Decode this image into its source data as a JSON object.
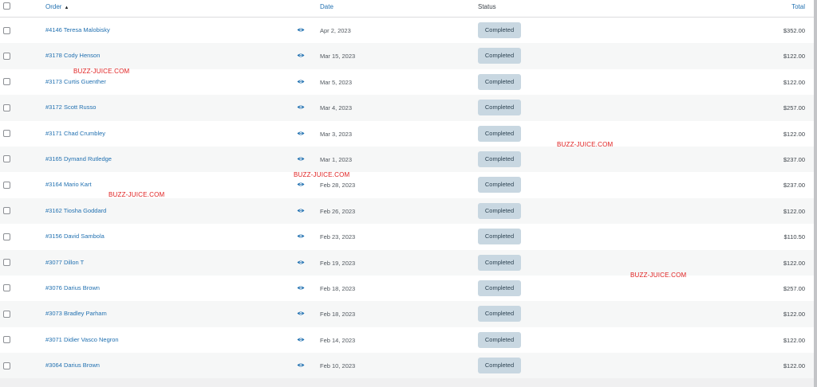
{
  "header": {
    "order_label": "Order",
    "sort_indicator": "▲",
    "date_label": "Date",
    "status_label": "Status",
    "total_label": "Total"
  },
  "icons": {
    "preview": "eye-icon",
    "sort": "sort-ascending-icon"
  },
  "colors": {
    "link": "#2271b1",
    "badge_bg": "#c8d7e1",
    "badge_text": "#2e4453",
    "watermark": "#e02020"
  },
  "orders": [
    {
      "order": "#4146 Teresa Malobisky",
      "date": "Apr 2, 2023",
      "status": "Completed",
      "total": "$352.00"
    },
    {
      "order": "#3178 Cody Henson",
      "date": "Mar 15, 2023",
      "status": "Completed",
      "total": "$122.00"
    },
    {
      "order": "#3173 Curtis Guenther",
      "date": "Mar 5, 2023",
      "status": "Completed",
      "total": "$122.00"
    },
    {
      "order": "#3172 Scott Russo",
      "date": "Mar 4, 2023",
      "status": "Completed",
      "total": "$257.00"
    },
    {
      "order": "#3171 Chad Crumbley",
      "date": "Mar 3, 2023",
      "status": "Completed",
      "total": "$122.00"
    },
    {
      "order": "#3165 Dymand Rutledge",
      "date": "Mar 1, 2023",
      "status": "Completed",
      "total": "$237.00"
    },
    {
      "order": "#3164 Mario Kart",
      "date": "Feb 28, 2023",
      "status": "Completed",
      "total": "$237.00"
    },
    {
      "order": "#3162 Tiosha Goddard",
      "date": "Feb 26, 2023",
      "status": "Completed",
      "total": "$122.00"
    },
    {
      "order": "#3156 David Sambola",
      "date": "Feb 23, 2023",
      "status": "Completed",
      "total": "$110.50"
    },
    {
      "order": "#3077 Dillon T",
      "date": "Feb 19, 2023",
      "status": "Completed",
      "total": "$122.00"
    },
    {
      "order": "#3076 Darius Brown",
      "date": "Feb 18, 2023",
      "status": "Completed",
      "total": "$257.00"
    },
    {
      "order": "#3073 Bradley Parham",
      "date": "Feb 18, 2023",
      "status": "Completed",
      "total": "$122.00"
    },
    {
      "order": "#3071 Didier Vasco Negron",
      "date": "Feb 14, 2023",
      "status": "Completed",
      "total": "$122.00"
    },
    {
      "order": "#3064 Darius Brown",
      "date": "Feb 10, 2023",
      "status": "Completed",
      "total": "$122.00"
    }
  ],
  "watermarks": [
    "BUZZ-JUICE.COM",
    "BUZZ-JUICE.COM",
    "BUZZ-JUICE.COM",
    "BUZZ-JUICE.COM",
    "BUZZ-JUICE.COM"
  ]
}
